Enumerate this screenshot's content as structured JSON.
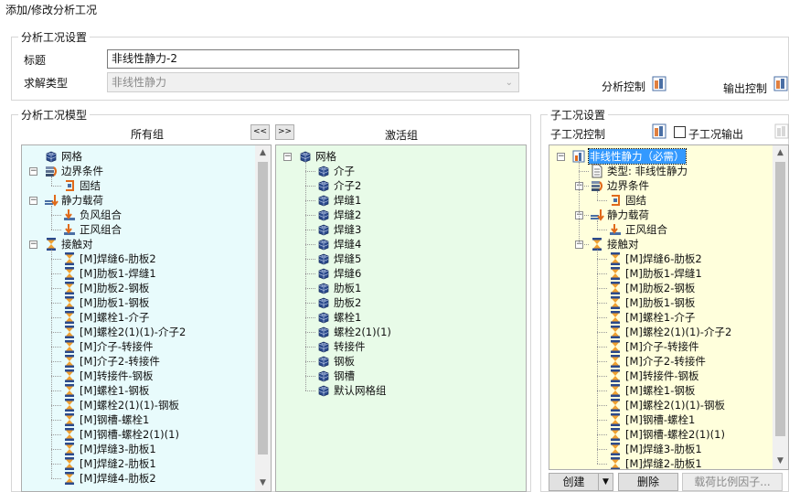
{
  "window": {
    "title": "添加/修改分析工况"
  },
  "settings": {
    "legend": "分析工况设置",
    "title_label": "标题",
    "title_value": "非线性静力-2",
    "solve_type_label": "求解类型",
    "solve_type_value": "非线性静力",
    "analysis_control_label": "分析控制",
    "output_control_label": "输出控制"
  },
  "model": {
    "legend": "分析工况模型",
    "all_groups_header": "所有组",
    "active_groups_header": "激活组",
    "move_left_label": "<<",
    "move_right_label": ">>",
    "all_tree": [
      {
        "label": "网格",
        "icon": "mesh-icon",
        "level": 0,
        "exp": ""
      },
      {
        "label": "边界条件",
        "icon": "boundary-icon",
        "level": 0,
        "exp": "−"
      },
      {
        "label": "固结",
        "icon": "fixed-support-icon",
        "level": 1,
        "exp": ""
      },
      {
        "label": "静力载荷",
        "icon": "static-load-icon",
        "level": 0,
        "exp": "−"
      },
      {
        "label": "负风组合",
        "icon": "load-combo-icon",
        "level": 1,
        "exp": ""
      },
      {
        "label": "正风组合",
        "icon": "load-combo-icon",
        "level": 1,
        "exp": ""
      },
      {
        "label": "接触对",
        "icon": "contact-icon",
        "level": 0,
        "exp": "−"
      },
      {
        "label": "[M]焊缝6-肋板2",
        "icon": "contact-icon",
        "level": 1,
        "exp": ""
      },
      {
        "label": "[M]肋板1-焊缝1",
        "icon": "contact-icon",
        "level": 1,
        "exp": ""
      },
      {
        "label": "[M]肋板2-钢板",
        "icon": "contact-icon",
        "level": 1,
        "exp": ""
      },
      {
        "label": "[M]肋板1-钢板",
        "icon": "contact-icon",
        "level": 1,
        "exp": ""
      },
      {
        "label": "[M]螺栓1-介子",
        "icon": "contact-icon",
        "level": 1,
        "exp": ""
      },
      {
        "label": "[M]螺栓2(1)(1)-介子2",
        "icon": "contact-icon",
        "level": 1,
        "exp": ""
      },
      {
        "label": "[M]介子-转接件",
        "icon": "contact-icon",
        "level": 1,
        "exp": ""
      },
      {
        "label": "[M]介子2-转接件",
        "icon": "contact-icon",
        "level": 1,
        "exp": ""
      },
      {
        "label": "[M]转接件-钢板",
        "icon": "contact-icon",
        "level": 1,
        "exp": ""
      },
      {
        "label": "[M]螺栓1-钢板",
        "icon": "contact-icon",
        "level": 1,
        "exp": ""
      },
      {
        "label": "[M]螺栓2(1)(1)-钢板",
        "icon": "contact-icon",
        "level": 1,
        "exp": ""
      },
      {
        "label": "[M]钢槽-螺栓1",
        "icon": "contact-icon",
        "level": 1,
        "exp": ""
      },
      {
        "label": "[M]钢槽-螺栓2(1)(1)",
        "icon": "contact-icon",
        "level": 1,
        "exp": ""
      },
      {
        "label": "[M]焊缝3-肋板1",
        "icon": "contact-icon",
        "level": 1,
        "exp": ""
      },
      {
        "label": "[M]焊缝2-肋板1",
        "icon": "contact-icon",
        "level": 1,
        "exp": ""
      },
      {
        "label": "[M]焊缝4-肋板2",
        "icon": "contact-icon",
        "level": 1,
        "exp": ""
      }
    ],
    "active_tree": [
      {
        "label": "网格",
        "icon": "mesh-icon",
        "level": 0,
        "exp": "−"
      },
      {
        "label": "介子",
        "icon": "mesh-icon",
        "level": 1,
        "exp": ""
      },
      {
        "label": "介子2",
        "icon": "mesh-icon",
        "level": 1,
        "exp": ""
      },
      {
        "label": "焊缝1",
        "icon": "mesh-icon",
        "level": 1,
        "exp": ""
      },
      {
        "label": "焊缝2",
        "icon": "mesh-icon",
        "level": 1,
        "exp": ""
      },
      {
        "label": "焊缝3",
        "icon": "mesh-icon",
        "level": 1,
        "exp": ""
      },
      {
        "label": "焊缝4",
        "icon": "mesh-icon",
        "level": 1,
        "exp": ""
      },
      {
        "label": "焊缝5",
        "icon": "mesh-icon",
        "level": 1,
        "exp": ""
      },
      {
        "label": "焊缝6",
        "icon": "mesh-icon",
        "level": 1,
        "exp": ""
      },
      {
        "label": "肋板1",
        "icon": "mesh-icon",
        "level": 1,
        "exp": ""
      },
      {
        "label": "肋板2",
        "icon": "mesh-icon",
        "level": 1,
        "exp": ""
      },
      {
        "label": "螺栓1",
        "icon": "mesh-icon",
        "level": 1,
        "exp": ""
      },
      {
        "label": "螺栓2(1)(1)",
        "icon": "mesh-icon",
        "level": 1,
        "exp": ""
      },
      {
        "label": "转接件",
        "icon": "mesh-icon",
        "level": 1,
        "exp": ""
      },
      {
        "label": "钢板",
        "icon": "mesh-icon",
        "level": 1,
        "exp": ""
      },
      {
        "label": "钢槽",
        "icon": "mesh-icon",
        "level": 1,
        "exp": ""
      },
      {
        "label": "默认网格组",
        "icon": "mesh-icon",
        "level": 1,
        "exp": ""
      }
    ]
  },
  "sub": {
    "legend": "子工况设置",
    "control_label": "子工况控制",
    "output_label": "子工况输出",
    "output_checked": false,
    "tree": [
      {
        "label": "非线性静力（必需）",
        "icon": "case-icon",
        "level": 0,
        "exp": "−",
        "selected": true
      },
      {
        "label": "类型: 非线性静力",
        "icon": "document-icon",
        "level": 1,
        "exp": ""
      },
      {
        "label": "边界条件",
        "icon": "boundary-icon",
        "level": 1,
        "exp": "−"
      },
      {
        "label": "固结",
        "icon": "fixed-support-icon",
        "level": 2,
        "exp": ""
      },
      {
        "label": "静力载荷",
        "icon": "static-load-icon",
        "level": 1,
        "exp": "−"
      },
      {
        "label": "正风组合",
        "icon": "load-combo-icon",
        "level": 2,
        "exp": ""
      },
      {
        "label": "接触对",
        "icon": "contact-icon",
        "level": 1,
        "exp": "−"
      },
      {
        "label": "[M]焊缝6-肋板2",
        "icon": "contact-icon",
        "level": 2,
        "exp": ""
      },
      {
        "label": "[M]肋板1-焊缝1",
        "icon": "contact-icon",
        "level": 2,
        "exp": ""
      },
      {
        "label": "[M]肋板2-钢板",
        "icon": "contact-icon",
        "level": 2,
        "exp": ""
      },
      {
        "label": "[M]肋板1-钢板",
        "icon": "contact-icon",
        "level": 2,
        "exp": ""
      },
      {
        "label": "[M]螺栓1-介子",
        "icon": "contact-icon",
        "level": 2,
        "exp": ""
      },
      {
        "label": "[M]螺栓2(1)(1)-介子2",
        "icon": "contact-icon",
        "level": 2,
        "exp": ""
      },
      {
        "label": "[M]介子-转接件",
        "icon": "contact-icon",
        "level": 2,
        "exp": ""
      },
      {
        "label": "[M]介子2-转接件",
        "icon": "contact-icon",
        "level": 2,
        "exp": ""
      },
      {
        "label": "[M]转接件-钢板",
        "icon": "contact-icon",
        "level": 2,
        "exp": ""
      },
      {
        "label": "[M]螺栓1-钢板",
        "icon": "contact-icon",
        "level": 2,
        "exp": ""
      },
      {
        "label": "[M]螺栓2(1)(1)-钢板",
        "icon": "contact-icon",
        "level": 2,
        "exp": ""
      },
      {
        "label": "[M]钢槽-螺栓1",
        "icon": "contact-icon",
        "level": 2,
        "exp": ""
      },
      {
        "label": "[M]钢槽-螺栓2(1)(1)",
        "icon": "contact-icon",
        "level": 2,
        "exp": ""
      },
      {
        "label": "[M]焊缝3-肋板1",
        "icon": "contact-icon",
        "level": 2,
        "exp": ""
      },
      {
        "label": "[M]焊缝2-肋板1",
        "icon": "contact-icon",
        "level": 2,
        "exp": ""
      }
    ],
    "create_label": "创建",
    "delete_label": "删除",
    "load_factor_label": "载荷比例因子..."
  },
  "colors": {
    "all_tree_bg": "#e8fbfc",
    "active_tree_bg": "#e8fbe8",
    "sub_tree_bg": "#ffffdc",
    "selected_bg": "#3399ff"
  }
}
